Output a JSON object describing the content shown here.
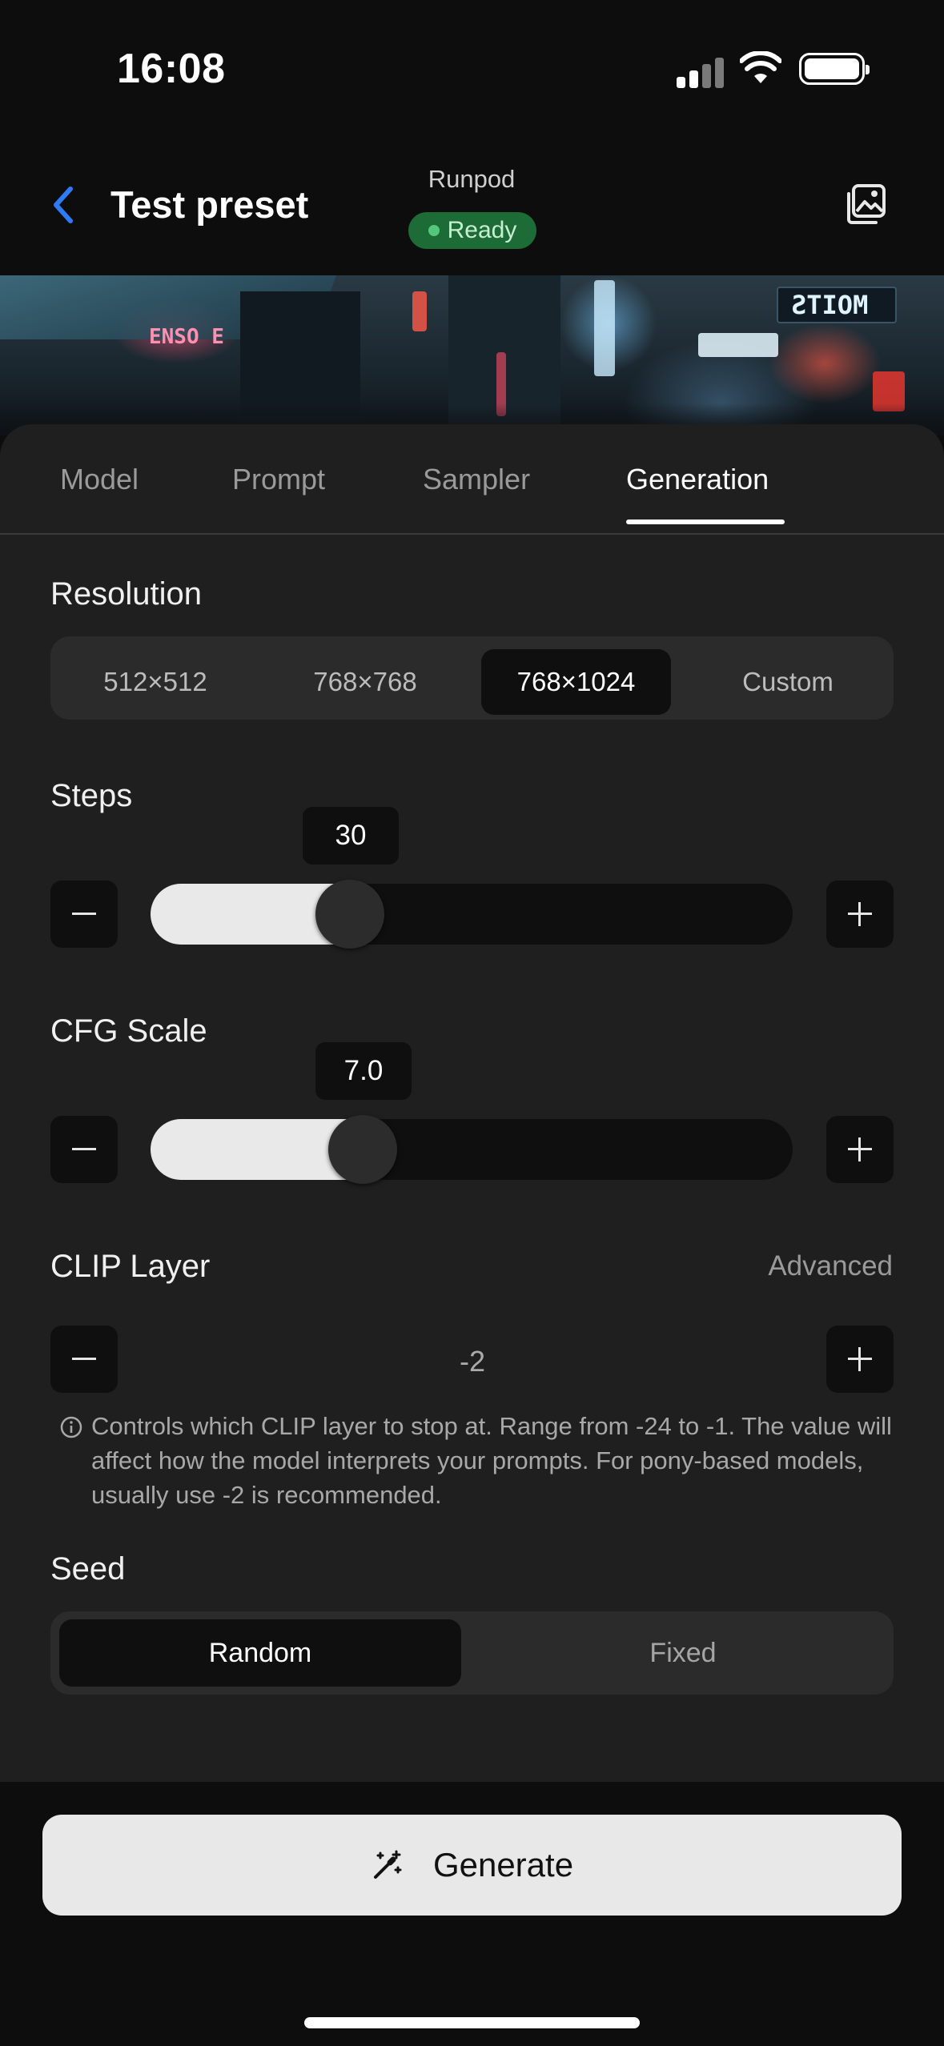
{
  "status_bar": {
    "time": "16:08"
  },
  "header": {
    "title": "Test preset",
    "provider": "Runpod",
    "status": "Ready",
    "colors": {
      "accent": "#2f7bf5",
      "ready_bg": "#1d6b37",
      "ready_text": "#c6eecf"
    }
  },
  "hero": {
    "sign_left": "ENSO E",
    "sign_right": "ƧTIOM"
  },
  "tabs": [
    {
      "label": "Model"
    },
    {
      "label": "Prompt"
    },
    {
      "label": "Sampler"
    },
    {
      "label": "Generation",
      "active": true
    }
  ],
  "resolution": {
    "title": "Resolution",
    "options": [
      "512×512",
      "768×768",
      "768×1024",
      "Custom"
    ],
    "selected": "768×1024"
  },
  "steps": {
    "title": "Steps",
    "value": "30",
    "fraction": 0.31
  },
  "cfg": {
    "title": "CFG Scale",
    "value": "7.0",
    "fraction": 0.33
  },
  "clip": {
    "title": "CLIP Layer",
    "advanced_label": "Advanced",
    "value": "-2",
    "info": "Controls which CLIP layer to stop at. Range from -24 to -1. The value will affect how the model interprets your prompts. For pony-based models, usually use -2 is recommended."
  },
  "seed": {
    "title": "Seed",
    "options": [
      "Random",
      "Fixed"
    ],
    "selected": "Random"
  },
  "generate_label": "Generate",
  "icons": {
    "back": "chevron-left-icon",
    "gallery": "image-gallery-icon",
    "decrement": "minus-icon",
    "increment": "plus-icon",
    "info": "info-circle-icon",
    "generate": "magic-wand-icon"
  }
}
